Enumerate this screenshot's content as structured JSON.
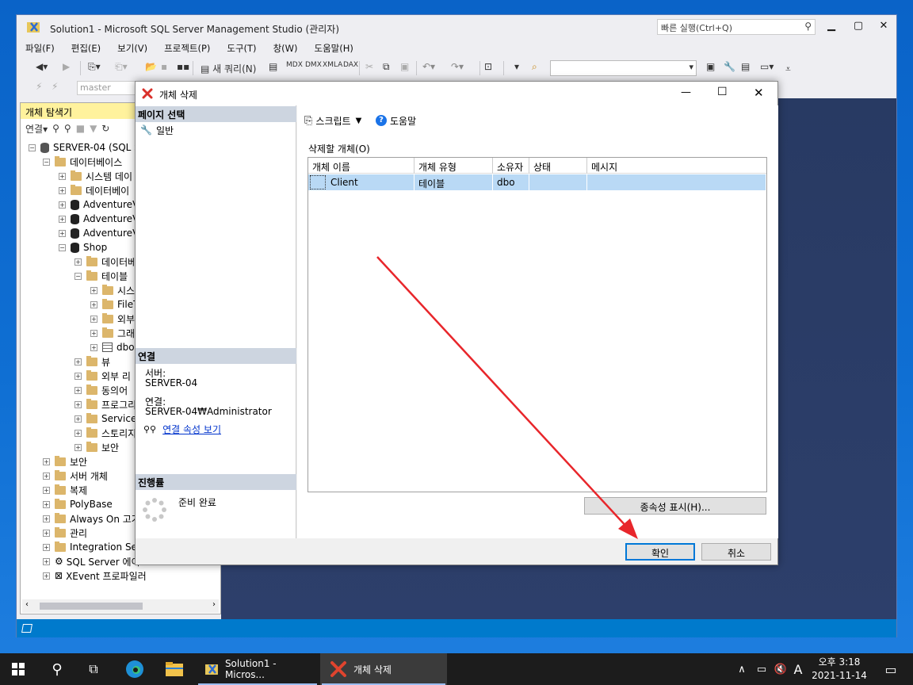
{
  "ssms": {
    "title": "Solution1 - Microsoft SQL Server Management Studio (관리자)",
    "quick_launch_placeholder": "빠른 실행(Ctrl+Q)",
    "menu": [
      "파일(F)",
      "편집(E)",
      "보기(V)",
      "프로젝트(P)",
      "도구(T)",
      "창(W)",
      "도움말(H)"
    ],
    "toolbar": {
      "new_query": "새 쿼리(N)",
      "db_combo": "master"
    }
  },
  "object_explorer": {
    "title": "개체 탐색기",
    "connect_label": "연결",
    "tree": [
      {
        "label": "SERVER-04 (SQL S",
        "level": 0,
        "exp": "−",
        "icon": "server"
      },
      {
        "label": "데이터베이스",
        "level": 1,
        "exp": "−",
        "icon": "folder"
      },
      {
        "label": "시스템 데이",
        "level": 2,
        "exp": "+",
        "icon": "folder"
      },
      {
        "label": "데이터베이",
        "level": 2,
        "exp": "+",
        "icon": "folder"
      },
      {
        "label": "AdventureV",
        "level": 2,
        "exp": "+",
        "icon": "db"
      },
      {
        "label": "AdventureV",
        "level": 2,
        "exp": "+",
        "icon": "db"
      },
      {
        "label": "AdventureV",
        "level": 2,
        "exp": "+",
        "icon": "db"
      },
      {
        "label": "Shop",
        "level": 2,
        "exp": "−",
        "icon": "db"
      },
      {
        "label": "데이터베",
        "level": 3,
        "exp": "+",
        "icon": "folder"
      },
      {
        "label": "테이블",
        "level": 3,
        "exp": "−",
        "icon": "folder"
      },
      {
        "label": "시스",
        "level": 4,
        "exp": "+",
        "icon": "folder"
      },
      {
        "label": "FileT",
        "level": 4,
        "exp": "+",
        "icon": "folder"
      },
      {
        "label": "외부",
        "level": 4,
        "exp": "+",
        "icon": "folder"
      },
      {
        "label": "그래",
        "level": 4,
        "exp": "+",
        "icon": "folder"
      },
      {
        "label": "dbo",
        "level": 4,
        "exp": "+",
        "icon": "table"
      },
      {
        "label": "뷰",
        "level": 3,
        "exp": "+",
        "icon": "folder"
      },
      {
        "label": "외부 리",
        "level": 3,
        "exp": "+",
        "icon": "folder"
      },
      {
        "label": "동의어",
        "level": 3,
        "exp": "+",
        "icon": "folder"
      },
      {
        "label": "프로그리",
        "level": 3,
        "exp": "+",
        "icon": "folder"
      },
      {
        "label": "Service",
        "level": 3,
        "exp": "+",
        "icon": "folder"
      },
      {
        "label": "스토리지",
        "level": 3,
        "exp": "+",
        "icon": "folder"
      },
      {
        "label": "보안",
        "level": 3,
        "exp": "+",
        "icon": "folder"
      },
      {
        "label": "보안",
        "level": 1,
        "exp": "+",
        "icon": "folder"
      },
      {
        "label": "서버 개체",
        "level": 1,
        "exp": "+",
        "icon": "folder"
      },
      {
        "label": "복제",
        "level": 1,
        "exp": "+",
        "icon": "folder"
      },
      {
        "label": "PolyBase",
        "level": 1,
        "exp": "+",
        "icon": "folder"
      },
      {
        "label": "Always On 고가",
        "level": 1,
        "exp": "+",
        "icon": "folder"
      },
      {
        "label": "관리",
        "level": 1,
        "exp": "+",
        "icon": "folder"
      },
      {
        "label": "Integration Ser",
        "level": 1,
        "exp": "+",
        "icon": "folder"
      },
      {
        "label": "SQL Server 에이",
        "level": 1,
        "exp": "+",
        "icon": "agent"
      },
      {
        "label": "XEvent 프로파일러",
        "level": 1,
        "exp": "+",
        "icon": "xevent"
      }
    ]
  },
  "dialog": {
    "title": "개체 삭제",
    "page_select_header": "페이지 선택",
    "page_general": "일반",
    "connection_header": "연결",
    "server_label": "서버:",
    "server_value": "SERVER-04",
    "connection_label": "연결:",
    "connection_value": "SERVER-04₩Administrator",
    "view_conn_props": "연결 속성 보기",
    "progress_header": "진행률",
    "progress_status": "준비 완료",
    "script_label": "스크립트",
    "help_label": "도움말",
    "objects_label": "삭제할 개체(O)",
    "columns": [
      "개체 이름",
      "개체 유형",
      "소유자",
      "상태",
      "메시지"
    ],
    "rows": [
      {
        "name": "Client",
        "type": "테이블",
        "owner": "dbo",
        "status": "",
        "message": ""
      }
    ],
    "dependencies_button": "종속성 표시(H)...",
    "ok_button": "확인",
    "cancel_button": "취소"
  },
  "taskbar": {
    "ssms_item": "Solution1 - Micros...",
    "dialog_item": "개체 삭제",
    "ime": "A",
    "time": "오후 3:18",
    "date": "2021-11-14"
  },
  "colors": {
    "annotation_arrow": "#e8262b",
    "selected_row": "#b9d9f5",
    "statusbar": "#007acc"
  }
}
